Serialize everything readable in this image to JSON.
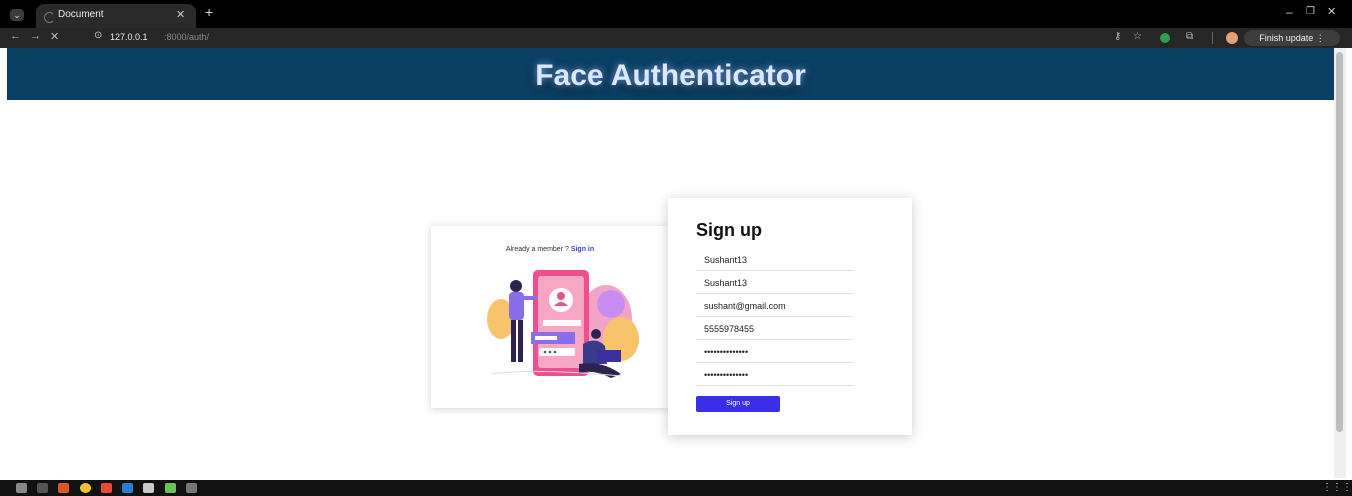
{
  "browser": {
    "tab_title": "Document",
    "url_host": "127.0.0.1",
    "url_path": ":8000/auth/",
    "finish_update_label": "Finish update ⋮"
  },
  "page": {
    "title": "Face Authenticator",
    "already_member": "Already a member ?",
    "sign_in_link": "Sign in",
    "signup_heading": "Sign up",
    "fields": [
      {
        "value": "Sushant13"
      },
      {
        "value": "Sushant13"
      },
      {
        "value": "sushant@gmail.com"
      },
      {
        "value": "5555978455"
      },
      {
        "value": "••••••••••••••"
      },
      {
        "value": "••••••••••••••"
      }
    ],
    "signup_button": "Sign up"
  },
  "colors": {
    "header_bg": "#0b3f63",
    "button_bg": "#3b2ee8",
    "link": "#3347d1"
  }
}
